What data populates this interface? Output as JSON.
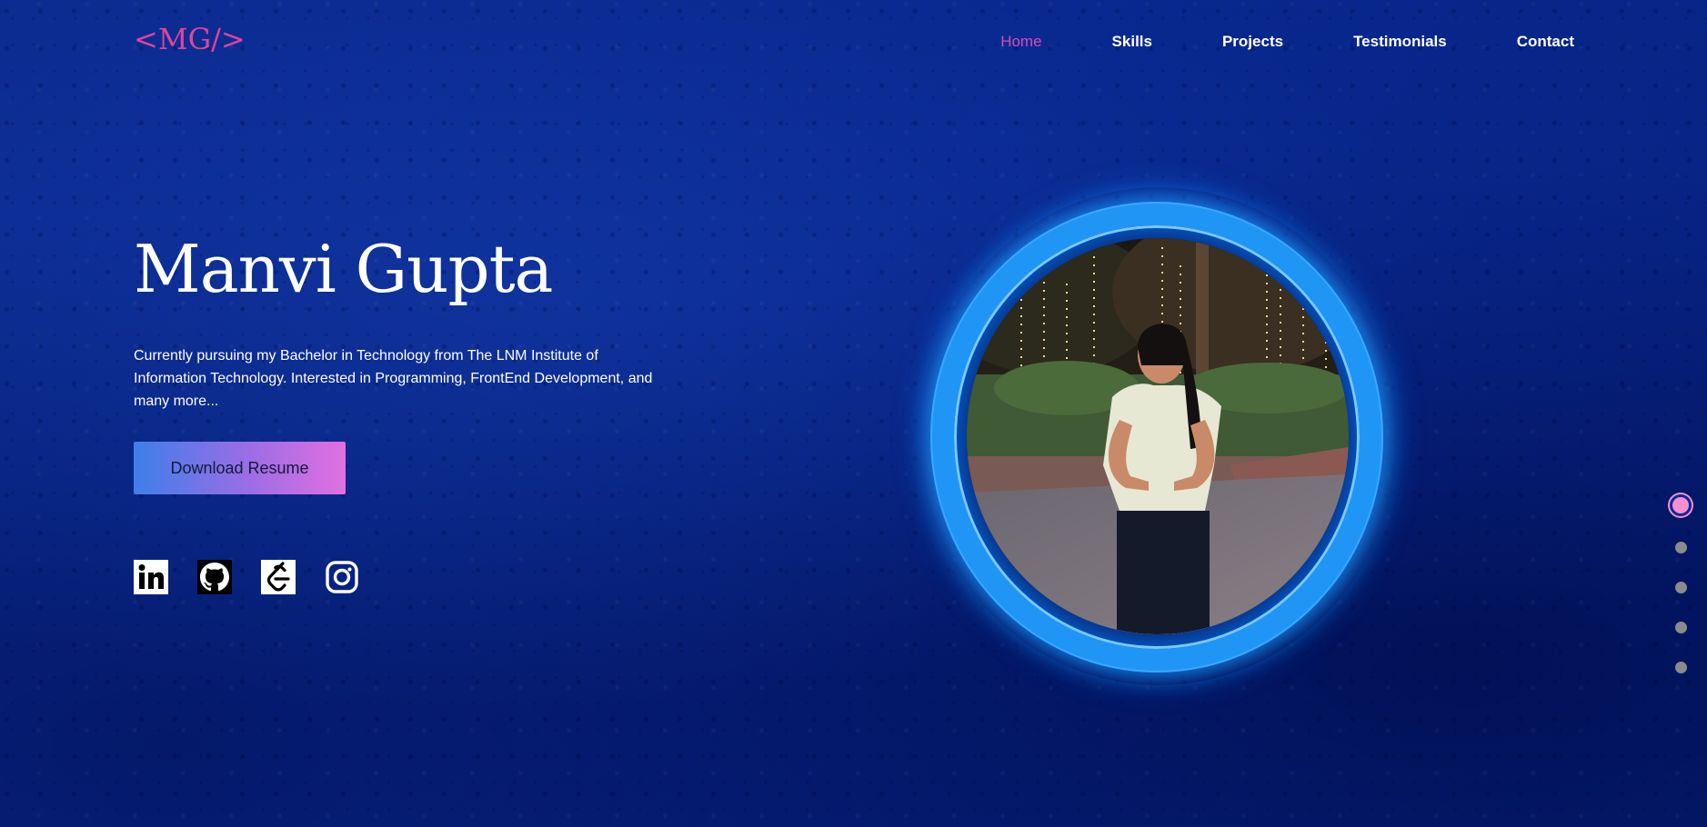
{
  "header": {
    "logo": "<MG/>",
    "nav": [
      {
        "label": "Home",
        "active": true
      },
      {
        "label": "Skills",
        "active": false
      },
      {
        "label": "Projects",
        "active": false
      },
      {
        "label": "Testimonials",
        "active": false
      },
      {
        "label": "Contact",
        "active": false
      }
    ]
  },
  "hero": {
    "name": "Manvi Gupta",
    "intro": "Currently pursuing my Bachelor in Technology from The LNM Institute of Information Technology. Interested in Programming, FrontEnd Development, and many more...",
    "button_label": "Download Resume",
    "socials": [
      "linkedin-icon",
      "github-icon",
      "leetcode-icon",
      "instagram-icon"
    ]
  },
  "section_indicator": {
    "count": 5,
    "active_index": 0
  },
  "colors": {
    "accent_pink": "#d64bb8",
    "logo_pink": "#e0449c",
    "ring_blue": "#1f96f5",
    "background": "#0b2a8f"
  }
}
